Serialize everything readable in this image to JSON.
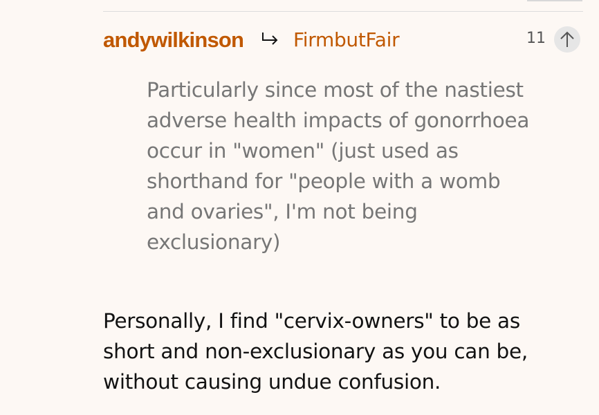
{
  "comment": {
    "author": "andywilkinson",
    "reply_to": "FirmbutFair",
    "recommend_count": "11",
    "quote_lines": [
      "Particularly since most of the nastiest",
      "adverse health impacts of gonorrhoea",
      "occur in \"women\" (just used as",
      "shorthand for \"people with a womb",
      "and ovaries\", I'm not being",
      "exclusionary)"
    ],
    "body_lines": [
      "Personally, I find \"cervix-owners\" to be as",
      "short and non-exclusionary as you can be,",
      "without causing undue confusion."
    ]
  },
  "icons": {
    "reply": "reply-arrow-icon",
    "recommend": "up-arrow-icon"
  },
  "colors": {
    "accent": "#c05800",
    "quote_text": "#767676",
    "body_text": "#121212",
    "background": "#fdf8f4"
  }
}
